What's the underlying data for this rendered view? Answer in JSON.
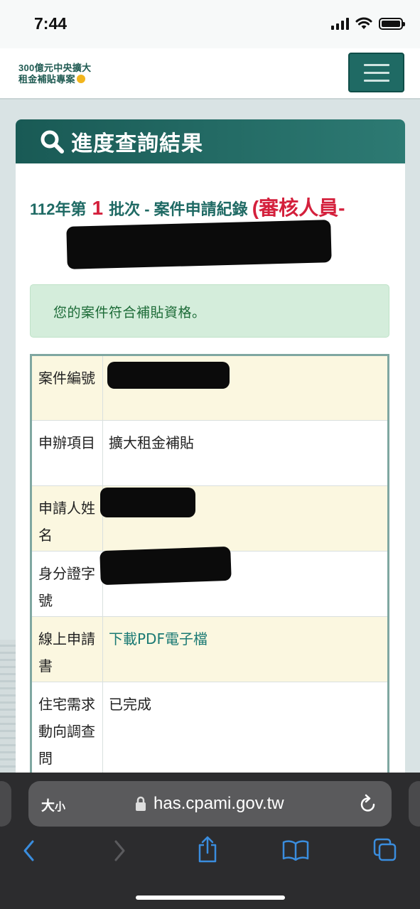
{
  "status_bar": {
    "time": "7:44"
  },
  "header": {
    "logo_line1": "300億元中央擴大",
    "logo_line2": "租金補貼專案",
    "menu_icon": "hamburger-menu-icon"
  },
  "card": {
    "title": "進度查詢結果",
    "search_icon": "search-icon",
    "batch_prefix": "112年第",
    "batch_number": "1",
    "batch_suffix": "批次 - 案件申請紀錄",
    "reviewer_prefix": "(審核人員-",
    "alert_message": "您的案件符合補貼資格。"
  },
  "table": {
    "rows": [
      {
        "label": "案件編號",
        "value": ""
      },
      {
        "label": "申辦項目",
        "value": "擴大租金補貼"
      },
      {
        "label": "申請人姓名",
        "value": ""
      },
      {
        "label": "身分證字號",
        "value": ""
      },
      {
        "label": "線上申請書",
        "value": "下載PDF電子檔"
      },
      {
        "label": "住宅需求動向調查問",
        "value": "已完成"
      }
    ]
  },
  "browser": {
    "text_size": "大",
    "text_size_small": "小",
    "url": "has.cpami.gov.tw",
    "icons": [
      "lock-icon",
      "reload-icon",
      "back-icon",
      "forward-icon",
      "share-icon",
      "bookmarks-icon",
      "tabs-icon"
    ]
  },
  "colors": {
    "primary": "#1f6a64",
    "accent_red": "#d4203c",
    "success_bg": "#d4eddb",
    "success_text": "#1c6b37"
  }
}
